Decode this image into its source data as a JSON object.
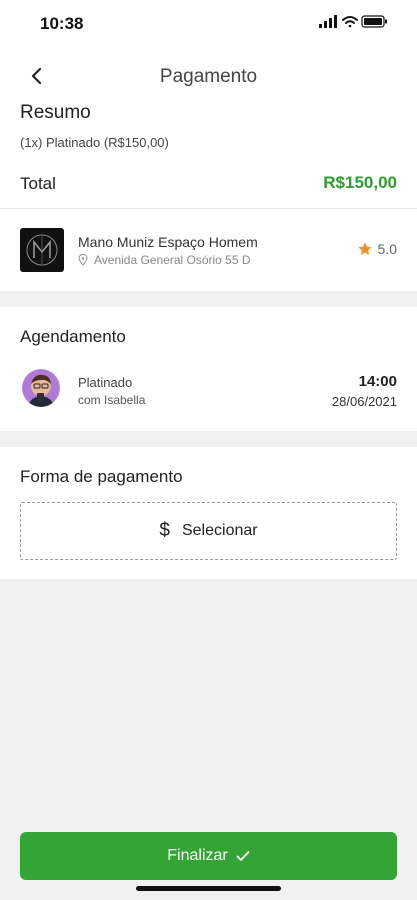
{
  "status": {
    "time": "10:38"
  },
  "nav": {
    "title": "Pagamento"
  },
  "summary": {
    "title": "Resumo",
    "line": "(1x) Platinado (R$150,00)",
    "total_label": "Total",
    "total_value": "R$150,00"
  },
  "shop": {
    "name": "Mano Muniz Espaço Homem",
    "address": "Avenida General Osório 55 D",
    "rating": "5.0"
  },
  "schedule": {
    "title": "Agendamento",
    "service": "Platinado",
    "professional": "com Isabella",
    "time": "14:00",
    "date": "28/06/2021"
  },
  "payment": {
    "title": "Forma de pagamento",
    "select_label": "Selecionar"
  },
  "footer": {
    "button_label": "Finalizar"
  },
  "colors": {
    "accent": "#34a534",
    "total": "#2e9d2e",
    "star": "#f0912d"
  },
  "icons": [
    "back-icon",
    "map-pin-icon",
    "star-icon",
    "dollar-icon",
    "check-icon",
    "wifi-icon",
    "battery-icon",
    "signal-icon"
  ]
}
